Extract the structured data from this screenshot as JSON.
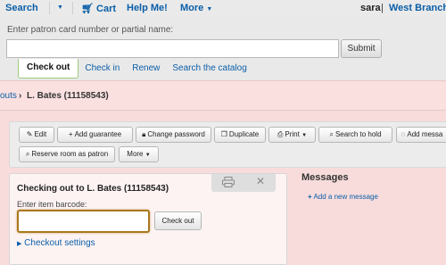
{
  "topnav": {
    "search": "Search",
    "cart": "Cart",
    "help": "Help Me!",
    "more": "More",
    "user": "sara",
    "branch": "West Branch"
  },
  "header": {
    "label": "Enter patron card number or partial name:",
    "input_value": "",
    "submit": "Submit",
    "tabs": [
      "Check out",
      "Check in",
      "Renew",
      "Search the catalog"
    ]
  },
  "breadcrumb": {
    "parent": "outs",
    "separator": "›",
    "current": "L. Bates (11158543)"
  },
  "toolbar": {
    "edit": "Edit",
    "add_guarantee": "Add guarantee",
    "change_password": "Change password",
    "duplicate": "Duplicate",
    "print": "Print",
    "search_to_hold": "Search to hold",
    "add_message": "Add messa",
    "reserve_room": "Reserve room as patron",
    "more": "More"
  },
  "checkout": {
    "title": "Checking out to L. Bates (11158543)",
    "barcode_label": "Enter item barcode:",
    "barcode_value": "",
    "button": "Check out",
    "settings": "Checkout settings"
  },
  "messages": {
    "title": "Messages",
    "add": "Add a new message"
  },
  "colors": {
    "link": "#0b5ea8",
    "pink_bg": "#f8dcdc",
    "focus_border": "#a9781e",
    "active_tab_border": "#9ccb7e"
  }
}
